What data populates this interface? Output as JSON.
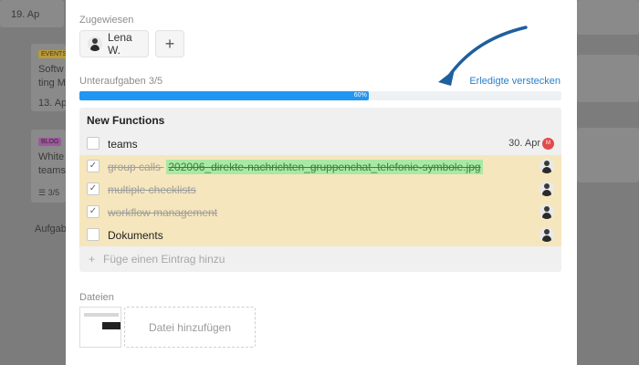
{
  "background_board": {
    "cards": [
      {
        "date": "19. Ap"
      },
      {
        "tag": "EVENTS",
        "title_line1": "Softw",
        "title_line2": "ting M",
        "date": "13. Ap"
      },
      {
        "tag": "BLOG",
        "title_line1": "White",
        "title_line2": "teams",
        "count": "3/5"
      }
    ],
    "column_footer": "Aufgab"
  },
  "assigned": {
    "label": "Zugewiesen",
    "assignee_name": "Lena W.",
    "add_label": "+"
  },
  "subtasks": {
    "label": "Unteraufgaben 3/5",
    "hide_done_label": "Erledigte verstecken",
    "progress": 0.6,
    "progress_label": "60%",
    "accent_color": "#2196f3"
  },
  "checklist": {
    "title": "New Functions",
    "items": [
      {
        "text": "teams",
        "done": false,
        "date": "30. Apr",
        "badge": "M"
      },
      {
        "text": "group calls",
        "file": "202006_direkte-nachrichten_gruppenchat_telefonie-symbole.jpg",
        "done": true,
        "checkmark": "✓"
      },
      {
        "text": "multiple checklists",
        "done": true,
        "checkmark": "✓"
      },
      {
        "text": "workflow management",
        "done": true,
        "checkmark": "✓"
      },
      {
        "text": "Dokuments",
        "done": false
      }
    ],
    "add_entry_icon": "+",
    "add_entry_label": "Füge einen Eintrag hinzu"
  },
  "files": {
    "label": "Dateien",
    "add_file_label": "Datei hinzufügen"
  }
}
